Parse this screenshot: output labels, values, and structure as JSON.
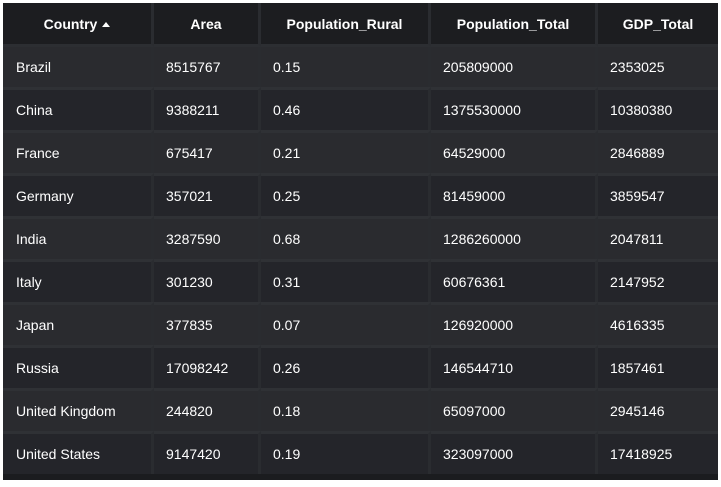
{
  "table": {
    "columns": [
      {
        "label": "Country",
        "sorted": "ascending"
      },
      {
        "label": "Area"
      },
      {
        "label": "Population_Rural"
      },
      {
        "label": "Population_Total"
      },
      {
        "label": "GDP_Total"
      }
    ],
    "rows": [
      [
        "Brazil",
        "8515767",
        "0.15",
        "205809000",
        "2353025"
      ],
      [
        "China",
        "9388211",
        "0.46",
        "1375530000",
        "10380380"
      ],
      [
        "France",
        "675417",
        "0.21",
        "64529000",
        "2846889"
      ],
      [
        "Germany",
        "357021",
        "0.25",
        "81459000",
        "3859547"
      ],
      [
        "India",
        "3287590",
        "0.68",
        "1286260000",
        "2047811"
      ],
      [
        "Italy",
        "301230",
        "0.31",
        "60676361",
        "2147952"
      ],
      [
        "Japan",
        "377835",
        "0.07",
        "126920000",
        "4616335"
      ],
      [
        "Russia",
        "17098242",
        "0.26",
        "146544710",
        "1857461"
      ],
      [
        "United Kingdom",
        "244820",
        "0.18",
        "65097000",
        "2945146"
      ],
      [
        "United States",
        "9147420",
        "0.19",
        "323097000",
        "17418925"
      ]
    ]
  },
  "colors": {
    "header_bg": "#1c1d20",
    "row_odd_bg": "#2a2b2f",
    "row_even_bg": "#24252a",
    "text": "#ffffff"
  },
  "icons": {
    "sort": "sort-ascending-icon"
  }
}
